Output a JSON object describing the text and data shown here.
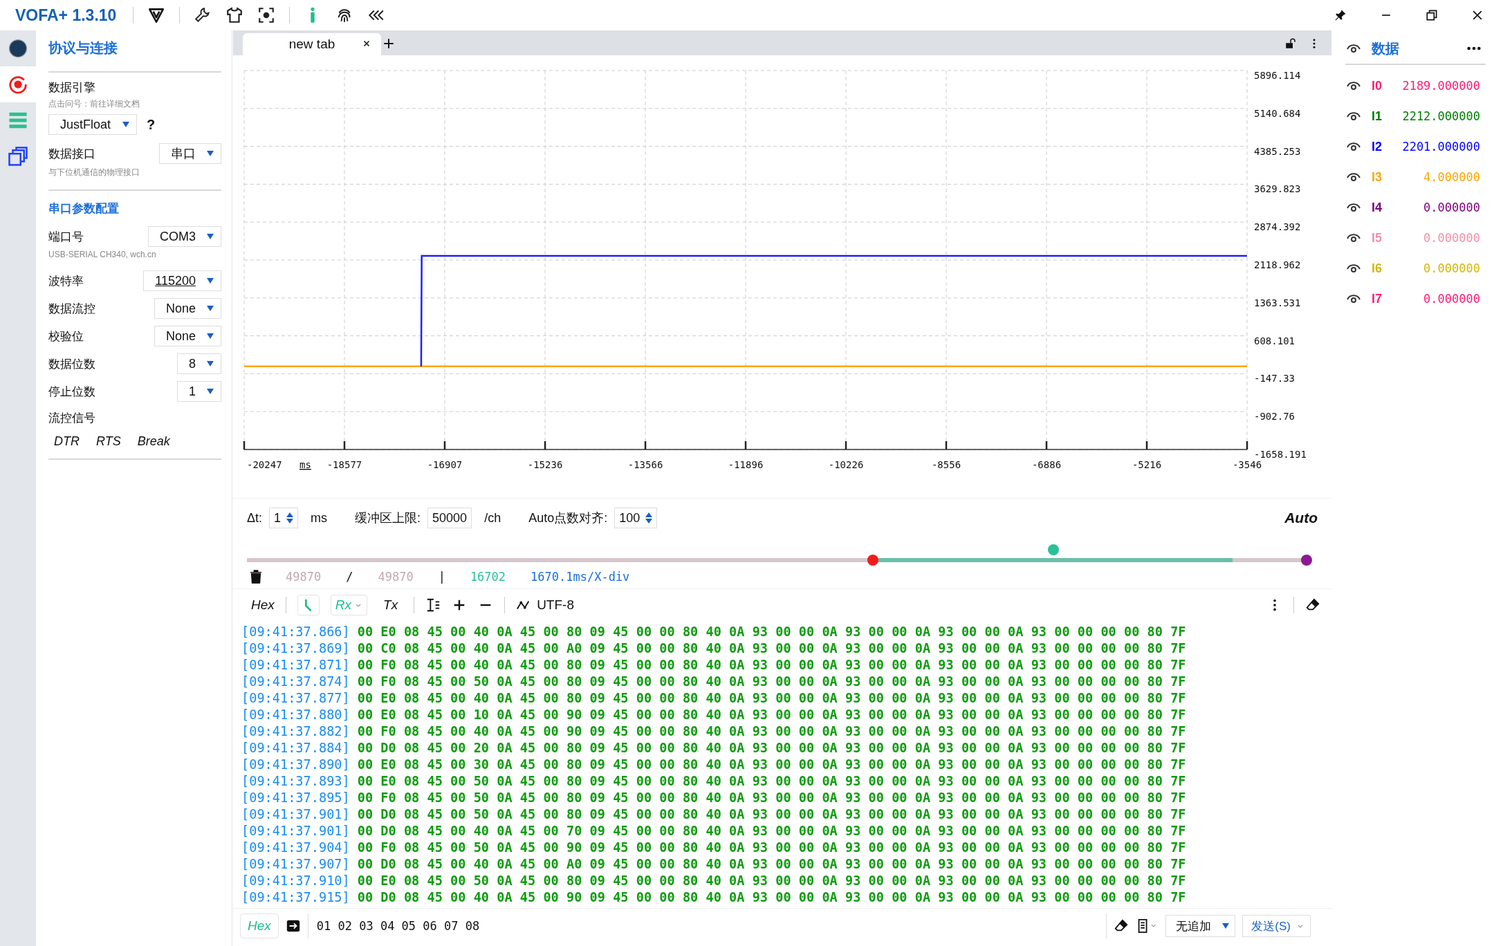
{
  "title_bar": {
    "app_name": "VOFA+ 1.3.10"
  },
  "rail": [
    {
      "kind": "connection",
      "selected": false
    },
    {
      "kind": "record",
      "selected": true
    },
    {
      "kind": "list",
      "selected": false
    },
    {
      "kind": "windows",
      "selected": false
    }
  ],
  "protocol_panel": {
    "title": "协议与连接",
    "engine": {
      "label": "数据引擎",
      "hint": "点击问号：前往详细文档",
      "value": "JustFloat",
      "help": "?"
    },
    "interface": {
      "label": "数据接口",
      "value": "串口",
      "hint": "与下位机通信的物理接口"
    },
    "serial_title": "串口参数配置",
    "serial_fields": [
      {
        "label": "端口号",
        "value": "COM3",
        "underlined": false,
        "hint": "USB-SERIAL CH340, wch.cn"
      },
      {
        "label": "波特率",
        "value": "115200",
        "underlined": true
      },
      {
        "label": "数据流控",
        "value": "None",
        "underlined": false
      },
      {
        "label": "校验位",
        "value": "None",
        "underlined": false
      },
      {
        "label": "数据位数",
        "value": "8",
        "underlined": false
      },
      {
        "label": "停止位数",
        "value": "1",
        "underlined": false
      }
    ],
    "flow_label": "流控信号",
    "flow_signals": [
      "DTR",
      "RTS",
      "Break"
    ]
  },
  "tab_bar": {
    "tabs": [
      {
        "label": "new tab",
        "selected": true
      }
    ]
  },
  "chart": {
    "chart_data": {
      "type": "line",
      "grid": true,
      "xlabel": "ms",
      "x": [
        -20247,
        -17300,
        -17290,
        -3546
      ],
      "series": [
        {
          "color": "#ffa500",
          "values": [
            0,
            0,
            0,
            0
          ]
        },
        {
          "color": "#2020ff",
          "values": [
            null,
            0,
            2200,
            2200
          ]
        }
      ],
      "xlim": [
        -20247,
        -3546
      ],
      "ylim": [
        -1658.191,
        5896.114
      ],
      "xticks": [
        -20247,
        -18577,
        -16907,
        -15236,
        -13566,
        -11896,
        -10226,
        -8556,
        -6886,
        -5216,
        -3546
      ],
      "yticks": [
        5896.114,
        5140.684,
        4385.253,
        3629.823,
        2874.392,
        2118.962,
        1363.531,
        608.101,
        -147.33,
        -902.76,
        -1658.191
      ]
    }
  },
  "controls": {
    "dt_label": "Δt:",
    "dt_value": "1",
    "dt_unit": "ms",
    "buffer_label": "缓冲区上限:",
    "buffer_value": "50000",
    "buffer_unit": "/ch",
    "align_label": "Auto点数对齐:",
    "align_value": "100",
    "mode": "Auto"
  },
  "timeline": {
    "window_start": {
      "level": 0.591
    },
    "window_end": {
      "level": 0.93
    },
    "cursor": {
      "level": 0.761
    },
    "end_handle": {
      "level": 1
    }
  },
  "stats": {
    "received": "49870",
    "separator": "/",
    "total": "49870",
    "divider": "|",
    "points": "16702",
    "scale": "1670.1ms/X-div"
  },
  "log_toolbar": {
    "hex": "Hex",
    "filters": [
      {
        "label": "Rx",
        "selected": true,
        "dropdown": true
      },
      {
        "label": "Tx",
        "selected": false,
        "dropdown": false
      }
    ],
    "encoding": "UTF-8"
  },
  "log": [
    {
      "time": "[09:41:37.866]",
      "bytes": "00 E0 08 45 00 40 0A 45 00 80 09 45 00 00 80 40 0A 93 00 00 0A 93 00 00 0A 93 00 00 0A 93 00 00 00 00 80 7F"
    },
    {
      "time": "[09:41:37.869]",
      "bytes": "00 C0 08 45 00 40 0A 45 00 A0 09 45 00 00 80 40 0A 93 00 00 0A 93 00 00 0A 93 00 00 0A 93 00 00 00 00 80 7F"
    },
    {
      "time": "[09:41:37.871]",
      "bytes": "00 F0 08 45 00 40 0A 45 00 80 09 45 00 00 80 40 0A 93 00 00 0A 93 00 00 0A 93 00 00 0A 93 00 00 00 00 80 7F"
    },
    {
      "time": "[09:41:37.874]",
      "bytes": "00 F0 08 45 00 50 0A 45 00 80 09 45 00 00 80 40 0A 93 00 00 0A 93 00 00 0A 93 00 00 0A 93 00 00 00 00 80 7F"
    },
    {
      "time": "[09:41:37.877]",
      "bytes": "00 E0 08 45 00 40 0A 45 00 80 09 45 00 00 80 40 0A 93 00 00 0A 93 00 00 0A 93 00 00 0A 93 00 00 00 00 80 7F"
    },
    {
      "time": "[09:41:37.880]",
      "bytes": "00 E0 08 45 00 10 0A 45 00 90 09 45 00 00 80 40 0A 93 00 00 0A 93 00 00 0A 93 00 00 0A 93 00 00 00 00 80 7F"
    },
    {
      "time": "[09:41:37.882]",
      "bytes": "00 F0 08 45 00 40 0A 45 00 90 09 45 00 00 80 40 0A 93 00 00 0A 93 00 00 0A 93 00 00 0A 93 00 00 00 00 80 7F"
    },
    {
      "time": "[09:41:37.884]",
      "bytes": "00 D0 08 45 00 20 0A 45 00 80 09 45 00 00 80 40 0A 93 00 00 0A 93 00 00 0A 93 00 00 0A 93 00 00 00 00 80 7F"
    },
    {
      "time": "[09:41:37.890]",
      "bytes": "00 E0 08 45 00 30 0A 45 00 80 09 45 00 00 80 40 0A 93 00 00 0A 93 00 00 0A 93 00 00 0A 93 00 00 00 00 80 7F"
    },
    {
      "time": "[09:41:37.893]",
      "bytes": "00 E0 08 45 00 50 0A 45 00 80 09 45 00 00 80 40 0A 93 00 00 0A 93 00 00 0A 93 00 00 0A 93 00 00 00 00 80 7F"
    },
    {
      "time": "[09:41:37.895]",
      "bytes": "00 F0 08 45 00 50 0A 45 00 80 09 45 00 00 80 40 0A 93 00 00 0A 93 00 00 0A 93 00 00 0A 93 00 00 00 00 80 7F"
    },
    {
      "time": "[09:41:37.901]",
      "bytes": "00 D0 08 45 00 50 0A 45 00 80 09 45 00 00 80 40 0A 93 00 00 0A 93 00 00 0A 93 00 00 0A 93 00 00 00 00 80 7F"
    },
    {
      "time": "[09:41:37.901]",
      "bytes": "00 D0 08 45 00 40 0A 45 00 70 09 45 00 00 80 40 0A 93 00 00 0A 93 00 00 0A 93 00 00 0A 93 00 00 00 00 80 7F"
    },
    {
      "time": "[09:41:37.904]",
      "bytes": "00 F0 08 45 00 50 0A 45 00 90 09 45 00 00 80 40 0A 93 00 00 0A 93 00 00 0A 93 00 00 0A 93 00 00 00 00 80 7F"
    },
    {
      "time": "[09:41:37.907]",
      "bytes": "00 D0 08 45 00 40 0A 45 00 A0 09 45 00 00 80 40 0A 93 00 00 0A 93 00 00 0A 93 00 00 0A 93 00 00 00 00 80 7F"
    },
    {
      "time": "[09:41:37.910]",
      "bytes": "00 E0 08 45 00 50 0A 45 00 80 09 45 00 00 80 40 0A 93 00 00 0A 93 00 00 0A 93 00 00 0A 93 00 00 00 00 80 7F"
    },
    {
      "time": "[09:41:37.915]",
      "bytes": "00 D0 08 45 00 40 0A 45 00 90 09 45 00 00 80 40 0A 93 00 00 0A 93 00 00 0A 93 00 00 0A 93 00 00 00 00 80 7F"
    }
  ],
  "send_bar": {
    "mode": "Hex",
    "value": "01 02 03 04 05 06 07 08",
    "suffix": "无追加",
    "send": "发送(S)"
  },
  "data_panel": {
    "title": "数据",
    "channels": [
      {
        "name": "I0",
        "value": "2189.000000",
        "color": "#ff1a75"
      },
      {
        "name": "I1",
        "value": "2212.000000",
        "color": "#008000"
      },
      {
        "name": "I2",
        "value": "2201.000000",
        "color": "#0000ff"
      },
      {
        "name": "I3",
        "value": "4.000000",
        "color": "#ffa500"
      },
      {
        "name": "I4",
        "value": "0.000000",
        "color": "#800080"
      },
      {
        "name": "I5",
        "value": "0.000000",
        "color": "#f590a8"
      },
      {
        "name": "I6",
        "value": "0.000000",
        "color": "#d4b800"
      },
      {
        "name": "I7",
        "value": "0.000000",
        "color": "#ff1a75"
      }
    ]
  }
}
